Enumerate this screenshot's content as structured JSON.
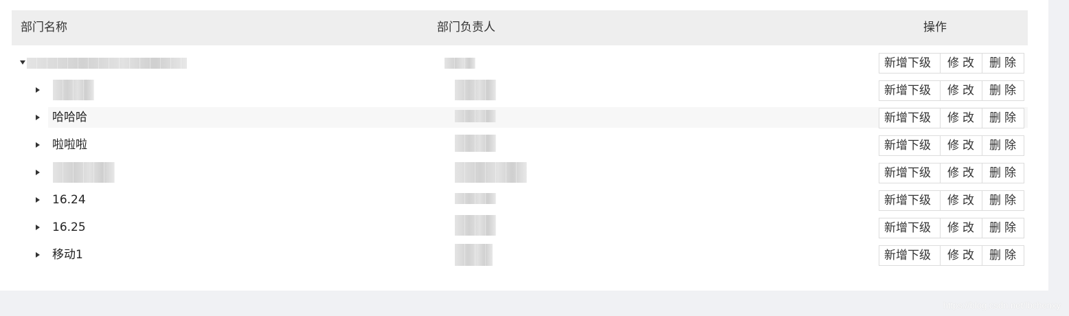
{
  "table": {
    "headers": {
      "name": "部门名称",
      "manager": "部门负责人",
      "action": "操作"
    },
    "actions": {
      "add": "新增下级",
      "edit": "修改",
      "delete": "删除"
    },
    "rows": [
      {
        "name": "",
        "redacted": true,
        "expanded": true,
        "level": 0
      },
      {
        "name": "",
        "redacted": true,
        "expanded": false,
        "level": 1
      },
      {
        "name": "哈哈哈",
        "redacted": false,
        "expanded": false,
        "level": 1,
        "highlighted": true
      },
      {
        "name": "啦啦啦",
        "redacted": false,
        "expanded": false,
        "level": 1
      },
      {
        "name": "",
        "redacted": true,
        "expanded": false,
        "level": 1
      },
      {
        "name": "16.24",
        "redacted": false,
        "expanded": false,
        "level": 1
      },
      {
        "name": "16.25",
        "redacted": false,
        "expanded": false,
        "level": 1
      },
      {
        "name": "移动1",
        "redacted": false,
        "expanded": false,
        "level": 1
      }
    ]
  },
  "watermark": "https://blog.csdn.net/lbchenxy"
}
